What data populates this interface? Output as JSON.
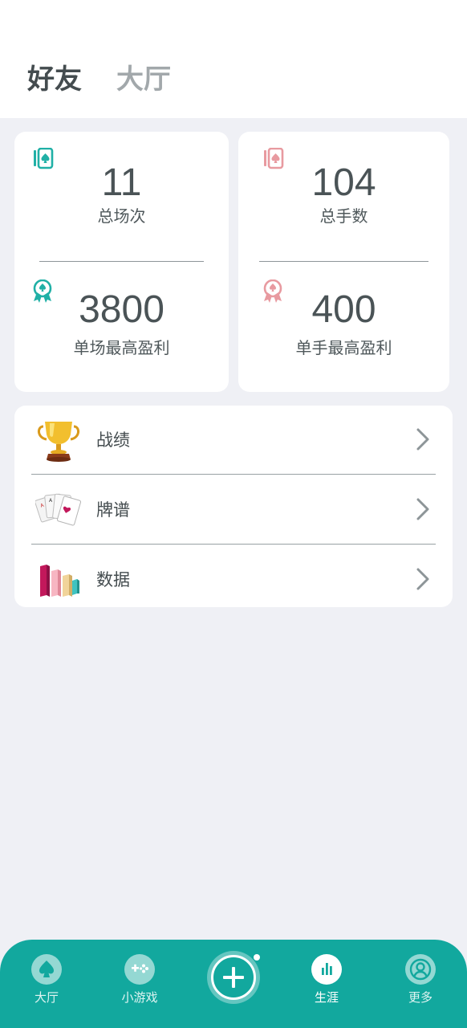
{
  "header": {
    "tabs": [
      {
        "label": "好友",
        "active": true
      },
      {
        "label": "大厅",
        "active": false
      }
    ]
  },
  "stats": {
    "total_games": {
      "value": "11",
      "label": "总场次",
      "icon": "card-icon",
      "color": "#20b0a6"
    },
    "total_hands": {
      "value": "104",
      "label": "总手数",
      "icon": "card-icon",
      "color": "#e89aa0"
    },
    "max_game_profit": {
      "value": "3800",
      "label": "单场最高盈利",
      "icon": "award-ribbon-icon",
      "color": "#20b0a6"
    },
    "max_hand_profit": {
      "value": "400",
      "label": "单手最高盈利",
      "icon": "award-ribbon-icon",
      "color": "#e89aa0"
    }
  },
  "menu": [
    {
      "label": "战绩",
      "icon": "trophy-icon"
    },
    {
      "label": "牌谱",
      "icon": "playing-cards-icon"
    },
    {
      "label": "数据",
      "icon": "bar-chart-icon"
    }
  ],
  "bottom_nav": {
    "items": [
      {
        "label": "大厅",
        "icon": "spade-icon",
        "active": false
      },
      {
        "label": "小游戏",
        "icon": "gamepad-icon",
        "active": false
      },
      {
        "label": "",
        "icon": "plus-icon",
        "active": false
      },
      {
        "label": "生涯",
        "icon": "bar-chart-icon",
        "active": true
      },
      {
        "label": "更多",
        "icon": "user-icon",
        "active": false
      }
    ],
    "accent": "#12a89e"
  }
}
